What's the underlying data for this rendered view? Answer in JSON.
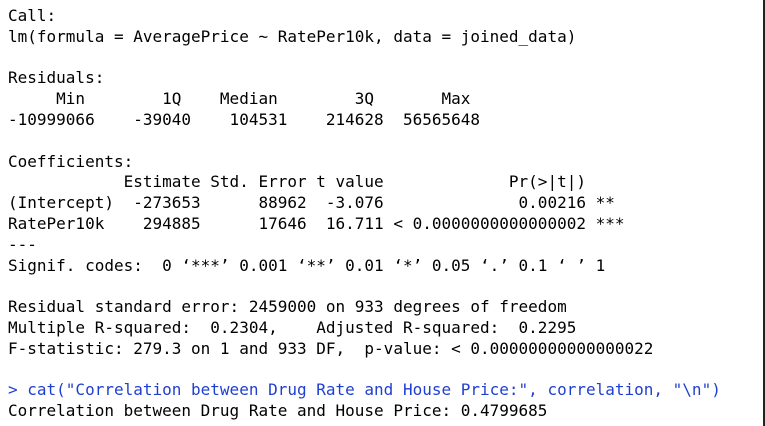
{
  "console": {
    "lines": [
      "Call:",
      "lm(formula = AveragePrice ~ RatePer10k, data = joined_data)",
      "",
      "Residuals:",
      "     Min        1Q    Median        3Q       Max ",
      "-10999066    -39040    104531    214628  56565648 ",
      "",
      "Coefficients:",
      "            Estimate Std. Error t value             Pr(>|t|)    ",
      "(Intercept)  -273653      88962  -3.076              0.00216 ** ",
      "RatePer10k    294885      17646  16.711 < 0.0000000000000002 ***",
      "---",
      "Signif. codes:  0 ‘***’ 0.001 ‘**’ 0.01 ‘*’ 0.05 ‘.’ 0.1 ‘ ’ 1",
      "",
      "Residual standard error: 2459000 on 933 degrees of freedom",
      "Multiple R-squared:  0.2304,    Adjusted R-squared:  0.2295 ",
      "F-statistic: 279.3 on 1 and 933 DF,  p-value: < 0.00000000000000022",
      "",
      "> cat(\"Correlation between Drug Rate and House Price:\", correlation, \"\\n\")",
      "Correlation between Drug Rate and House Price: 0.4799685 "
    ]
  },
  "colors": {
    "output_text": "#000000",
    "command_text": "#1f3fd1",
    "background": "#ffffff"
  }
}
